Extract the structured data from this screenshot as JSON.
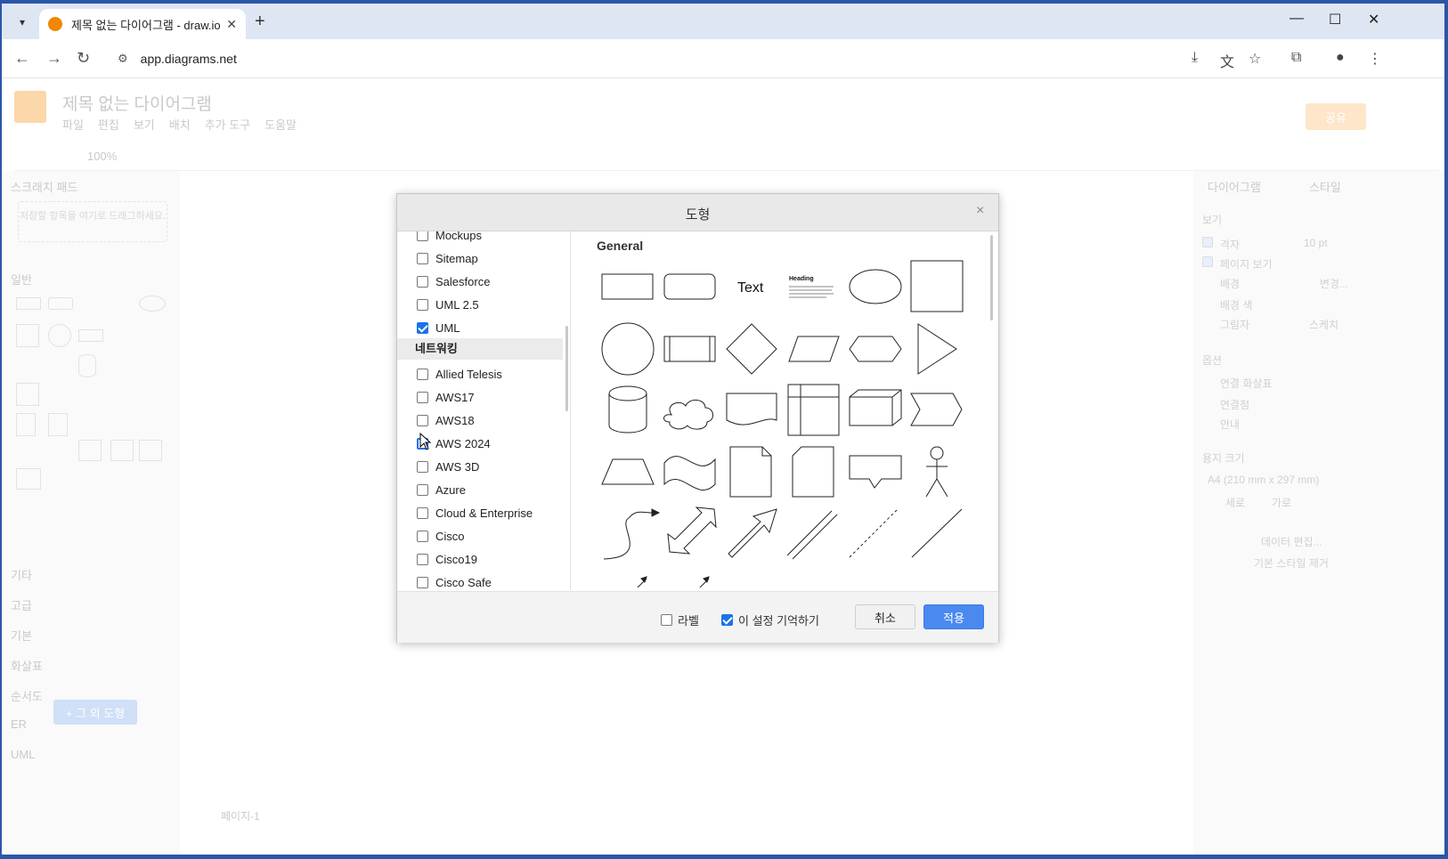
{
  "browser": {
    "tab_title": "제목 없는 다이어그램 - draw.io",
    "url": "app.diagrams.net",
    "new_tab": "+",
    "close": "✕",
    "minimize": "—",
    "maximize": "☐",
    "window_close": "✕"
  },
  "app": {
    "doc_title": "제목 없는 다이어그램",
    "menu": [
      "파일",
      "편집",
      "보기",
      "배치",
      "추가 도구",
      "도움말"
    ],
    "share": "공유",
    "zoom": "100%",
    "left_panel": {
      "scratchpad": "스크래치 패드",
      "scratch_hint": "저장할 항목을 여기로 드래그하세요.",
      "general": "일반",
      "sections": [
        "기타",
        "고급",
        "기본",
        "화살표",
        "순서도",
        "ER",
        "UML"
      ],
      "more_shapes": "+ 그 외 도형"
    },
    "right_panel": {
      "tab_diagram": "다이어그램",
      "tab_style": "스타일",
      "view": "보기",
      "grid": "격자",
      "grid_size": "10 pt",
      "page_view": "페이지 보기",
      "background": "배경",
      "change": "변경...",
      "bg_color": "배경 색",
      "shadow": "그림자",
      "sketch": "스케치",
      "options": "옵션",
      "connection_arrows": "연결 화살표",
      "connection_points": "연결점",
      "guides": "안내",
      "paper_size": "용지 크기",
      "paper_value": "A4 (210 mm x 297 mm)",
      "portrait": "세로",
      "landscape": "가로",
      "edit_data": "데이터 편집...",
      "clear_style": "기본 스타일 제거"
    },
    "page_tab": "페이지-1"
  },
  "dialog": {
    "title": "도형",
    "close": "×",
    "libraries_top": [
      {
        "label": "Mockups",
        "checked": false
      },
      {
        "label": "Sitemap",
        "checked": false
      },
      {
        "label": "Salesforce",
        "checked": false
      },
      {
        "label": "UML 2.5",
        "checked": false
      },
      {
        "label": "UML",
        "checked": true
      }
    ],
    "section_networking": "네트워킹",
    "libraries_net": [
      {
        "label": "Allied Telesis",
        "checked": false
      },
      {
        "label": "AWS17",
        "checked": false
      },
      {
        "label": "AWS18",
        "checked": false
      },
      {
        "label": "AWS 2024",
        "checked": false
      },
      {
        "label": "AWS 3D",
        "checked": false
      },
      {
        "label": "Azure",
        "checked": false
      },
      {
        "label": "Cloud & Enterprise",
        "checked": false
      },
      {
        "label": "Cisco",
        "checked": false
      },
      {
        "label": "Cisco19",
        "checked": false
      },
      {
        "label": "Cisco Safe",
        "checked": false
      }
    ],
    "preview_title": "General",
    "preview_text_shape": "Text",
    "preview_heading_shape": "Heading",
    "footer": {
      "labels": "라벨",
      "labels_checked": false,
      "remember": "이 설정 기억하기",
      "remember_checked": true,
      "cancel": "취소",
      "apply": "적용"
    }
  }
}
